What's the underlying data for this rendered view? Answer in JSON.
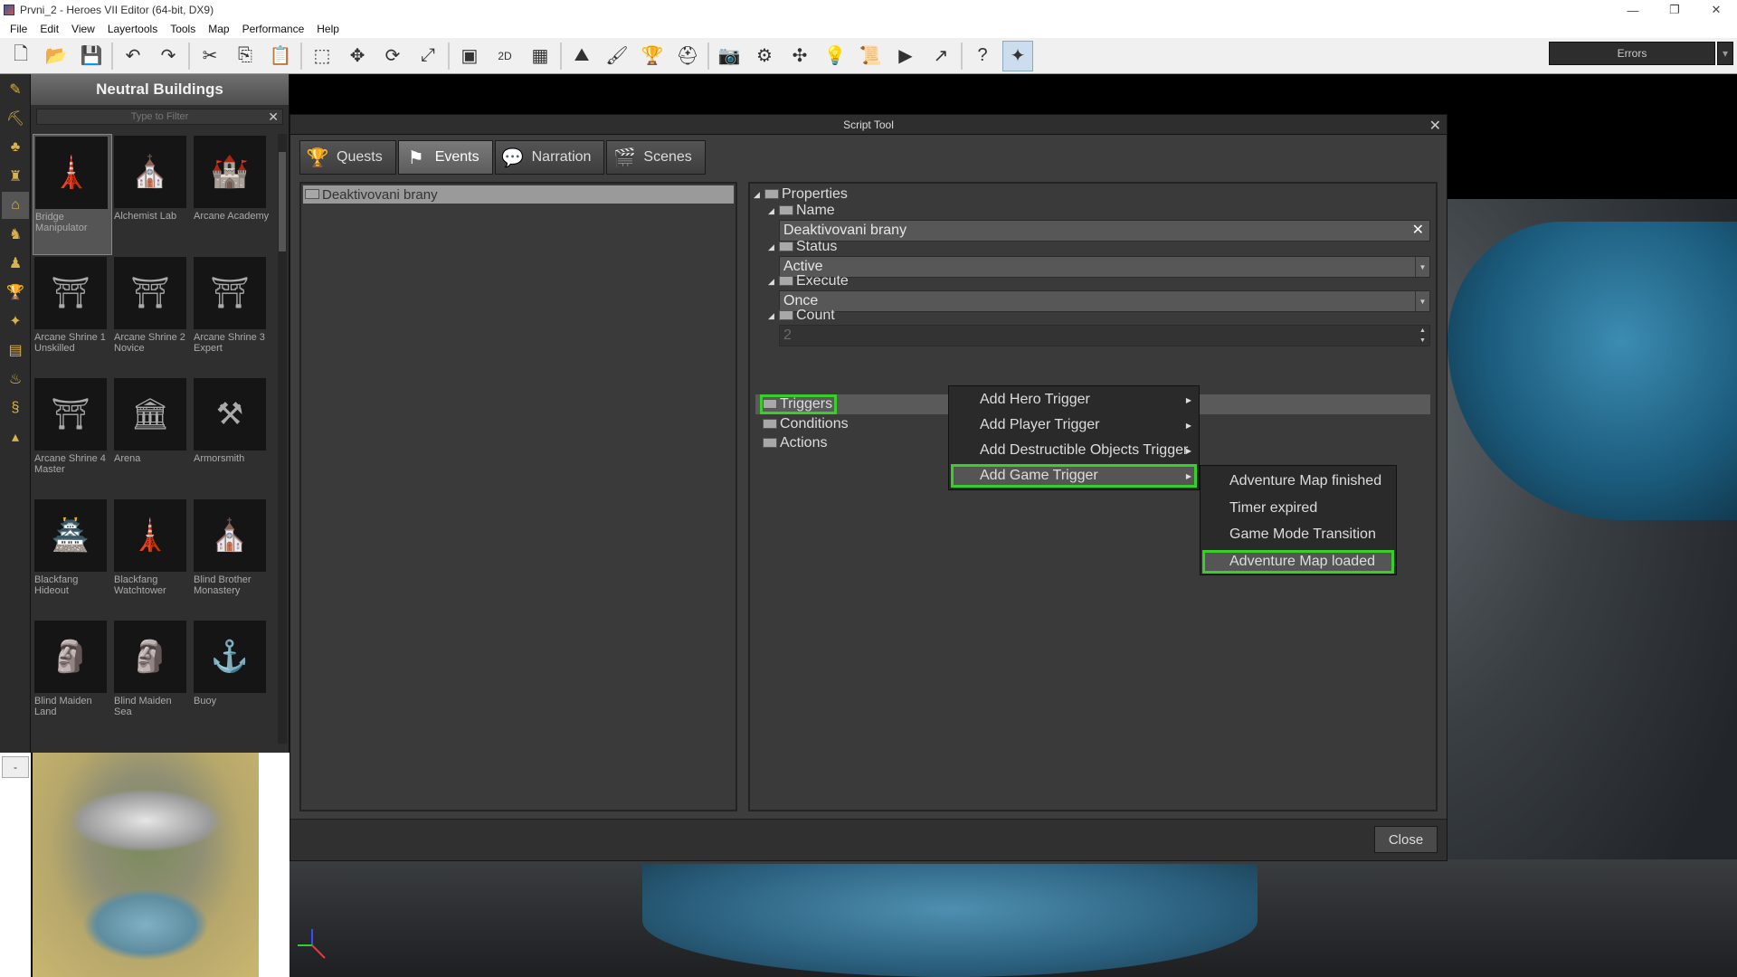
{
  "window": {
    "title": "Prvni_2 - Heroes VII Editor (64-bit, DX9)",
    "controls": {
      "minimize": "—",
      "restore": "❐",
      "close": "✕"
    }
  },
  "menu": [
    "File",
    "Edit",
    "View",
    "Layertools",
    "Tools",
    "Map",
    "Performance",
    "Help"
  ],
  "toolbar": {
    "errors_label": "Errors",
    "errors_handle": "▾",
    "buttons": [
      {
        "icon": "new-file-icon",
        "glyph": "🗋"
      },
      {
        "icon": "open-folder-icon",
        "glyph": "📂"
      },
      {
        "icon": "save-icon",
        "glyph": "💾"
      },
      {
        "icon": "undo-icon",
        "glyph": "↶"
      },
      {
        "icon": "redo-icon",
        "glyph": "↷"
      },
      {
        "icon": "cut-icon",
        "glyph": "✂"
      },
      {
        "icon": "copy-icon",
        "glyph": "⎘"
      },
      {
        "icon": "paste-icon",
        "glyph": "📋"
      },
      {
        "icon": "select-icon",
        "glyph": "⬚"
      },
      {
        "icon": "move-icon",
        "glyph": "✥"
      },
      {
        "icon": "rotate-icon",
        "glyph": "⟳"
      },
      {
        "icon": "scale-icon",
        "glyph": "⤢"
      },
      {
        "icon": "view-3d-icon",
        "glyph": "▣"
      },
      {
        "icon": "view-2d-icon",
        "glyph": "2D"
      },
      {
        "icon": "grid-icon",
        "glyph": "▦"
      },
      {
        "icon": "terrain-icon",
        "glyph": "⛰"
      },
      {
        "icon": "paint-icon",
        "glyph": "🖌"
      },
      {
        "icon": "trophy-icon",
        "glyph": "🏆"
      },
      {
        "icon": "helmet-icon",
        "glyph": "⛑"
      },
      {
        "icon": "camera-icon",
        "glyph": "📷"
      },
      {
        "icon": "settings-gears-icon",
        "glyph": "⚙"
      },
      {
        "icon": "navigate-icon",
        "glyph": "✣"
      },
      {
        "icon": "lightbulb-icon",
        "glyph": "💡"
      },
      {
        "icon": "script-icon",
        "glyph": "📜"
      },
      {
        "icon": "play-icon",
        "glyph": "▶"
      },
      {
        "icon": "export-icon",
        "glyph": "↗"
      },
      {
        "icon": "help-icon",
        "glyph": "?"
      },
      {
        "icon": "script-tool-icon",
        "glyph": "✦"
      }
    ]
  },
  "left_tools": [
    {
      "icon": "pen-tool-icon",
      "glyph": "✎"
    },
    {
      "icon": "pickaxe-icon",
      "glyph": "⛏"
    },
    {
      "icon": "tree-icon",
      "glyph": "♣"
    },
    {
      "icon": "castle-icon",
      "glyph": "♜"
    },
    {
      "icon": "neutral-building-icon",
      "glyph": "⌂"
    },
    {
      "icon": "hero-icon",
      "glyph": "♞"
    },
    {
      "icon": "creature-icon",
      "glyph": "♟"
    },
    {
      "icon": "goblet-icon",
      "glyph": "🏆"
    },
    {
      "icon": "crystal-icon",
      "glyph": "✦"
    },
    {
      "icon": "chest-icon",
      "glyph": "▤"
    },
    {
      "icon": "lantern-icon",
      "glyph": "♨"
    },
    {
      "icon": "scroll-icon",
      "glyph": "§"
    },
    {
      "icon": "misc-icon",
      "glyph": "▴"
    }
  ],
  "browser": {
    "title": "Neutral Buildings",
    "filter_placeholder": "Type to Filter",
    "filter_clear": "✕",
    "items": [
      {
        "label": "Bridge Manipulator",
        "icon": "bridge-manipulator-icon",
        "glyph": "🗼"
      },
      {
        "label": "Alchemist Lab",
        "icon": "alchemist-lab-icon",
        "glyph": "⛪"
      },
      {
        "label": "Arcane Academy",
        "icon": "arcane-academy-icon",
        "glyph": "🏰"
      },
      {
        "label": "Arcane Shrine 1 Unskilled",
        "icon": "arcane-shrine-1-icon",
        "glyph": "⛩"
      },
      {
        "label": "Arcane Shrine 2 Novice",
        "icon": "arcane-shrine-2-icon",
        "glyph": "⛩"
      },
      {
        "label": "Arcane Shrine 3 Expert",
        "icon": "arcane-shrine-3-icon",
        "glyph": "⛩"
      },
      {
        "label": "Arcane Shrine 4 Master",
        "icon": "arcane-shrine-4-icon",
        "glyph": "⛩"
      },
      {
        "label": "Arena",
        "icon": "arena-icon",
        "glyph": "🏛"
      },
      {
        "label": "Armorsmith",
        "icon": "armorsmith-icon",
        "glyph": "⚒"
      },
      {
        "label": "Blackfang Hideout",
        "icon": "blackfang-hideout-icon",
        "glyph": "🏯"
      },
      {
        "label": "Blackfang Watchtower",
        "icon": "blackfang-watchtower-icon",
        "glyph": "🗼"
      },
      {
        "label": "Blind Brother Monastery",
        "icon": "blind-brother-monastery-icon",
        "glyph": "⛪"
      },
      {
        "label": "Blind Maiden Land",
        "icon": "blind-maiden-land-icon",
        "glyph": "🗿"
      },
      {
        "label": "Blind Maiden Sea",
        "icon": "blind-maiden-sea-icon",
        "glyph": "🗿"
      },
      {
        "label": "Buoy",
        "icon": "buoy-icon",
        "glyph": "⚓"
      }
    ]
  },
  "minimap_collapse": "-",
  "dialog": {
    "title": "Script Tool",
    "close_x": "✕",
    "close_button": "Close",
    "tabs": [
      {
        "label": "Quests",
        "icon": "grail-icon",
        "glyph": "🏆",
        "active": false
      },
      {
        "label": "Events",
        "icon": "events-flag-icon",
        "glyph": "⚑",
        "active": true
      },
      {
        "label": "Narration",
        "icon": "speech-bubble-icon",
        "glyph": "💬",
        "active": false
      },
      {
        "label": "Scenes",
        "icon": "scenes-icon",
        "glyph": "🎬",
        "active": false
      }
    ],
    "events": [
      "Deaktivovani brany"
    ],
    "properties": {
      "root": "Properties",
      "name_label": "Name",
      "name_value": "Deaktivovani brany",
      "status_label": "Status",
      "status_value": "Active",
      "execute_label": "Execute",
      "execute_value": "Once",
      "count_label": "Count",
      "count_value": "2",
      "triggers": "Triggers",
      "conditions": "Conditions",
      "actions": "Actions"
    }
  },
  "context_menu": {
    "items": [
      "Add Hero Trigger",
      "Add Player Trigger",
      "Add Destructible Objects Trigger",
      "Add Game Trigger"
    ],
    "active_index": 3,
    "submenu": [
      "Adventure Map finished",
      "Timer expired",
      "Game Mode Transition",
      "Adventure Map loaded"
    ],
    "submenu_active_index": 3
  },
  "colors": {
    "highlight": "#38d028",
    "panel": "#3a3a3a"
  }
}
